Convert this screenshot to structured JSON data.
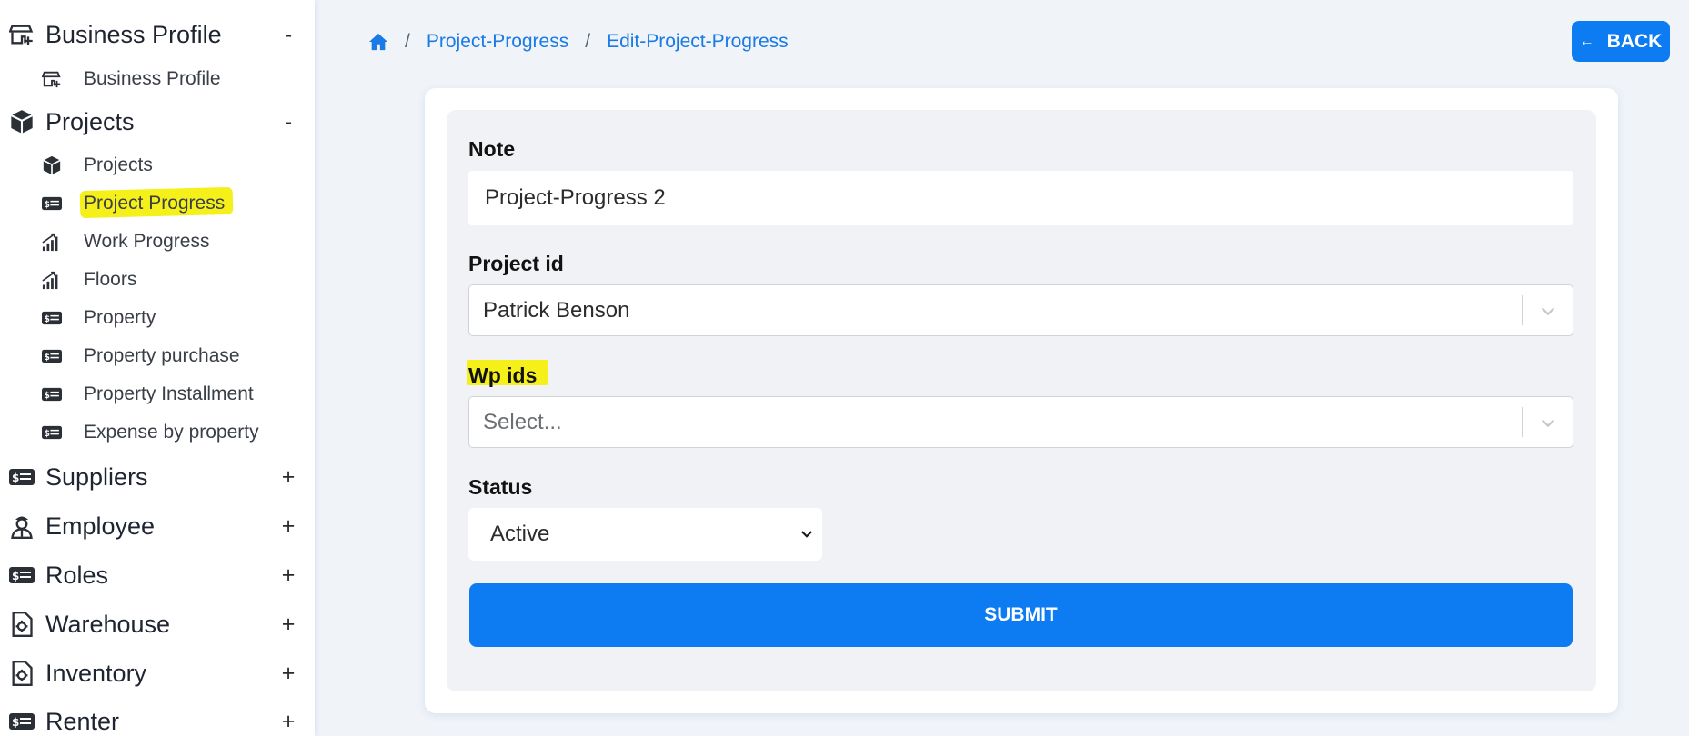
{
  "sidebar": {
    "groups": [
      {
        "label": "Business Profile",
        "toggle": "-",
        "icon": "store-icon"
      },
      {
        "label": "Projects",
        "toggle": "-",
        "icon": "cube-icon"
      },
      {
        "label": "Suppliers",
        "toggle": "+",
        "icon": "money-bill-icon"
      },
      {
        "label": "Employee",
        "toggle": "+",
        "icon": "user-tie-icon"
      },
      {
        "label": "Roles",
        "toggle": "+",
        "icon": "money-bill-icon"
      },
      {
        "label": "Warehouse",
        "toggle": "+",
        "icon": "file-gear-icon"
      },
      {
        "label": "Inventory",
        "toggle": "+",
        "icon": "file-gear-icon"
      },
      {
        "label": "Renter",
        "toggle": "+",
        "icon": "money-bill-icon"
      }
    ],
    "business_items": [
      {
        "label": "Business Profile",
        "icon": "store-icon"
      }
    ],
    "project_items": [
      {
        "label": "Projects",
        "icon": "cube-icon"
      },
      {
        "label": "Project Progress",
        "icon": "money-bill-icon"
      },
      {
        "label": "Work Progress",
        "icon": "signal-bars-icon"
      },
      {
        "label": "Floors",
        "icon": "signal-bars-icon"
      },
      {
        "label": "Property",
        "icon": "money-bill-icon"
      },
      {
        "label": "Property purchase",
        "icon": "money-bill-icon"
      },
      {
        "label": "Property Installment",
        "icon": "money-bill-icon"
      },
      {
        "label": "Expense by property",
        "icon": "money-bill-icon"
      }
    ]
  },
  "breadcrumb": {
    "home_icon": "home-icon",
    "separator": "/",
    "items": [
      "Project-Progress",
      "Edit-Project-Progress"
    ]
  },
  "back_button": {
    "label": "BACK",
    "icon": "arrow-left-icon"
  },
  "form": {
    "note": {
      "label": "Note",
      "value": "Project-Progress 2"
    },
    "project_id": {
      "label": "Project id",
      "value": "Patrick Benson"
    },
    "wp_ids": {
      "label": "Wp ids",
      "placeholder": "Select..."
    },
    "status": {
      "label": "Status",
      "value": "Active"
    },
    "submit_label": "SUBMIT"
  },
  "colors": {
    "accent": "#0d7cf2",
    "link": "#1a7ae6",
    "highlight": "#f5f01a",
    "page_bg": "#f0f4f9"
  }
}
